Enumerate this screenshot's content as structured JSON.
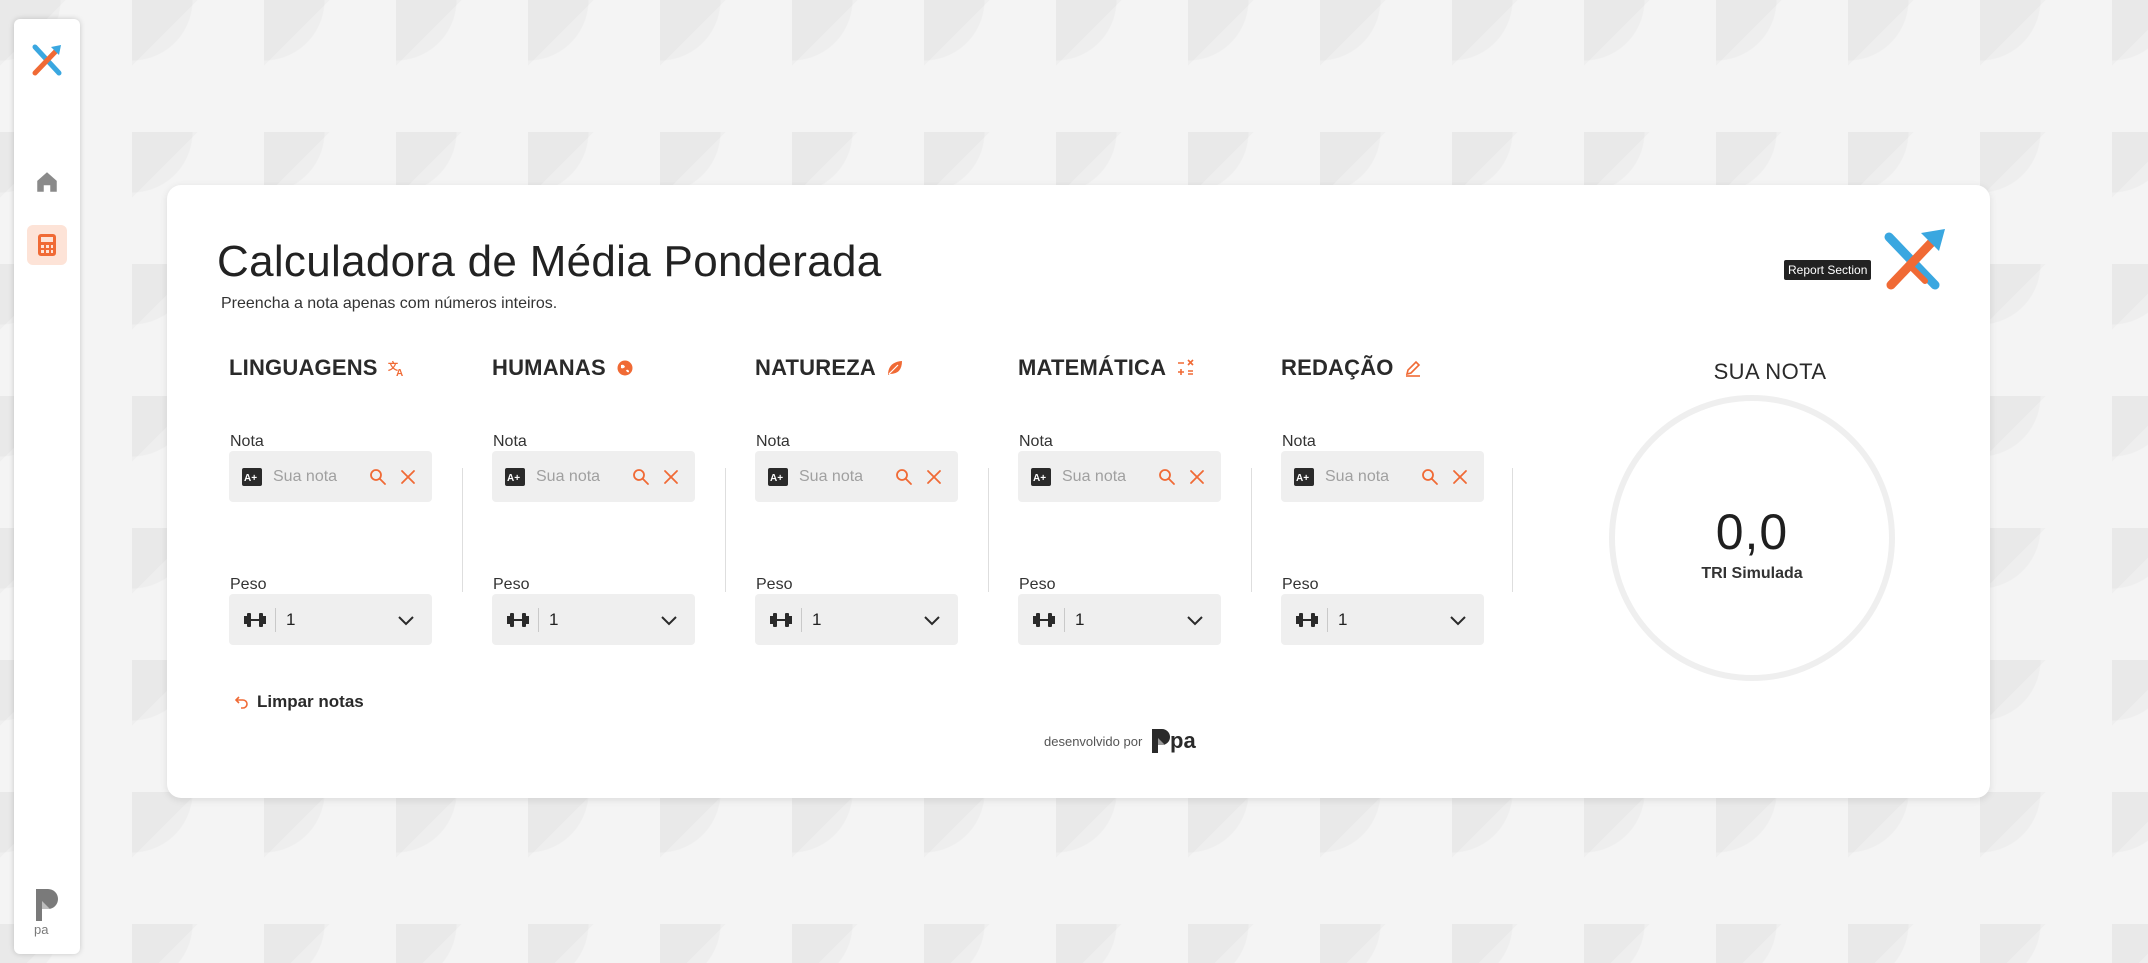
{
  "app": {
    "title": "Calculadora de Média Ponderada",
    "subtitle": "Preencha a nota apenas com números inteiros.",
    "tooltip": "Report Section"
  },
  "colors": {
    "accent": "#f06a35",
    "brand_blue": "#3aa7e0",
    "input_bg": "#efefef"
  },
  "sidebar": {
    "items": [
      {
        "icon": "home-icon"
      },
      {
        "icon": "calculator-icon",
        "active": true
      }
    ]
  },
  "subjects": [
    {
      "name": "LINGUAGENS",
      "icon": "translate-icon",
      "nota_label": "Nota",
      "nota_placeholder": "Sua nota",
      "peso_label": "Peso",
      "peso_value": "1"
    },
    {
      "name": "HUMANAS",
      "icon": "globe-icon",
      "nota_label": "Nota",
      "nota_placeholder": "Sua nota",
      "peso_label": "Peso",
      "peso_value": "1"
    },
    {
      "name": "NATUREZA",
      "icon": "leaf-icon",
      "nota_label": "Nota",
      "nota_placeholder": "Sua nota",
      "peso_label": "Peso",
      "peso_value": "1"
    },
    {
      "name": "MATEMÁTICA",
      "icon": "math-operations-icon",
      "nota_label": "Nota",
      "nota_placeholder": "Sua nota",
      "peso_label": "Peso",
      "peso_value": "1"
    },
    {
      "name": "REDAÇÃO",
      "icon": "pencil-icon",
      "nota_label": "Nota",
      "nota_placeholder": "Sua nota",
      "peso_label": "Peso",
      "peso_value": "1"
    }
  ],
  "result": {
    "title": "SUA NOTA",
    "score": "0,0",
    "subtitle": "TRI Simulada"
  },
  "actions": {
    "clear_label": "Limpar notas"
  },
  "footer": {
    "text": "desenvolvido por"
  }
}
